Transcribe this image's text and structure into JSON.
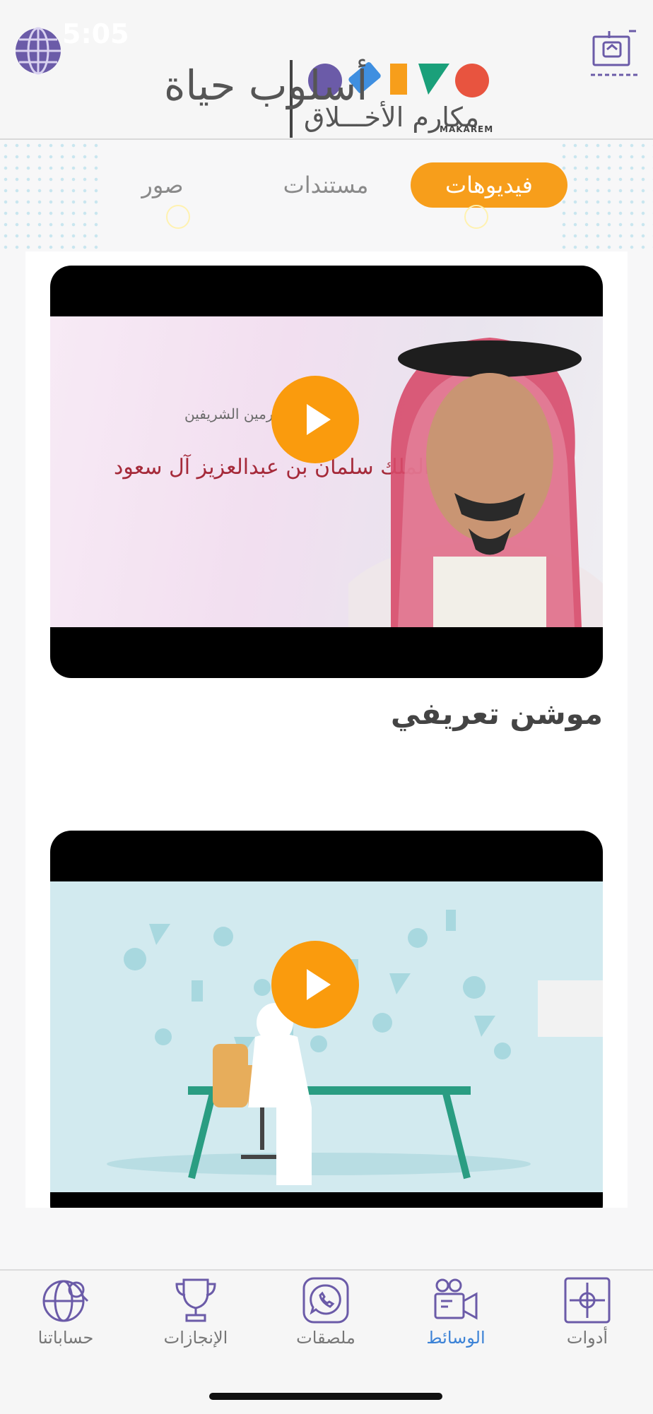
{
  "status_bar": {
    "time": "5:05"
  },
  "header": {
    "brand": "مكارم الأخـــلاق",
    "brand_sub": "MAKAREM",
    "slogan": "أسلوب حياة",
    "colors": {
      "purple": "#6b5ba8",
      "blue": "#3f8fe0",
      "orange": "#f79e1b",
      "green": "#1aa07a",
      "red": "#e8543f"
    }
  },
  "tabs": [
    {
      "label": "فيديوهات",
      "active": true
    },
    {
      "label": "مستندات",
      "active": false
    },
    {
      "label": "صور",
      "active": false
    }
  ],
  "videos": [
    {
      "title": "موشن تعريفي",
      "thumb_caption_small": "خادم الحرمين الشريفين",
      "thumb_caption_large": "الملك سلمان بن عبدالعزيز آل سعود"
    },
    {
      "title": ""
    }
  ],
  "bottom_nav": [
    {
      "label": "أدوات",
      "icon": "tools-icon",
      "active": false
    },
    {
      "label": "الوسائط",
      "icon": "video-camera-icon",
      "active": true
    },
    {
      "label": "ملصقات",
      "icon": "whatsapp-icon",
      "active": false
    },
    {
      "label": "الإنجازات",
      "icon": "trophy-icon",
      "active": false
    },
    {
      "label": "حساباتنا",
      "icon": "globe-search-icon",
      "active": false
    }
  ],
  "accent_color": "#f79e1b",
  "active_nav_color": "#3b82d6",
  "icon_color": "#6b5ba8"
}
